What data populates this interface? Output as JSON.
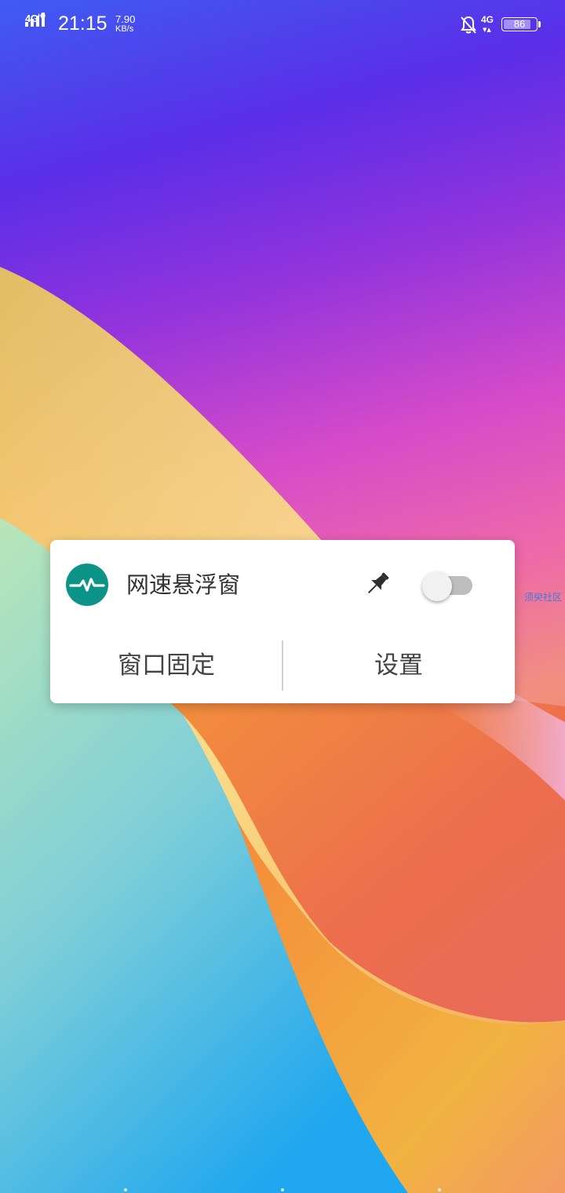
{
  "status_bar": {
    "network_left": "4G",
    "network_left_badge": "HD",
    "time": "21:15",
    "net_speed_value": "7.90",
    "net_speed_unit": "KB/s",
    "network_right": "4G",
    "battery_level": "86"
  },
  "floating_window": {
    "title": "网速悬浮窗",
    "toggle_on": false,
    "buttons": {
      "pin_window": "窗口固定",
      "settings": "设置"
    }
  },
  "side_label": "须臾社区",
  "colors": {
    "app_icon_bg": "#0d9488",
    "toggle_track_off": "#bdbdbd",
    "side_label": "#3e7dd8"
  },
  "icons": {
    "app": "pulse-line-icon",
    "pin": "pushpin-icon",
    "notifications": "bell-muted-icon"
  }
}
